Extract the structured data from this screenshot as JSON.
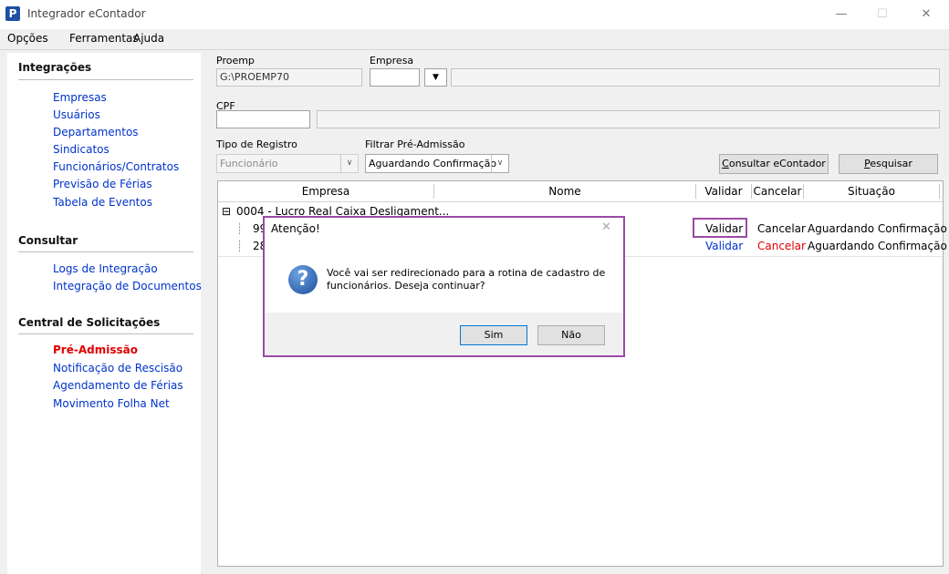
{
  "window": {
    "title": "Integrador eContador",
    "app_icon_glyph": "P",
    "controls": {
      "minimize": "—",
      "maximize": "☐",
      "close": "✕"
    }
  },
  "menu": [
    "Opções",
    "Ferramentas",
    "Ajuda"
  ],
  "sidebar": {
    "sections": [
      {
        "title": "Integrações",
        "items": [
          "Empresas",
          "Usuários",
          "Departamentos",
          "Sindicatos",
          "Funcionários/Contratos",
          "Previsão de Férias",
          "Tabela de Eventos"
        ]
      },
      {
        "title": "Consultar",
        "items": [
          "Logs de Integração",
          "Integração de Documentos"
        ]
      },
      {
        "title": "Central de Solicitações",
        "items": [
          "Pré-Admissão",
          "Notificação de Rescisão",
          "Agendamento de Férias",
          "Movimento Folha Net"
        ],
        "active": "Pré-Admissão"
      }
    ]
  },
  "form": {
    "proemp_label": "Proemp",
    "proemp_value": "G:\\PROEMP70",
    "empresa_label": "Empresa",
    "empresa_value": "",
    "empresa_name": "",
    "cpf_label": "CPF",
    "cpf_value": "",
    "cpf_name": "",
    "tipo_registro_label": "Tipo de Registro",
    "tipo_registro_value": "Funcionário",
    "filtrar_label": "Filtrar Pré-Admissão",
    "filtrar_value": "Aguardando Confirmação",
    "consultar_button": "Consultar eContador",
    "pesquisar_button": "Pesquisar"
  },
  "grid": {
    "columns": [
      "Empresa",
      "Nome",
      "Validar",
      "Cancelar",
      "Situação"
    ],
    "group": {
      "toggle": "⊟",
      "label": "0004 - Lucro Real Caixa Desligament..."
    },
    "rows": [
      {
        "id": "99",
        "validar": "Validar",
        "cancelar": "Cancelar",
        "situacao": "Aguardando Confirmação"
      },
      {
        "id": "28",
        "validar": "Validar",
        "cancelar": "Cancelar",
        "situacao": "Aguardando Confirmação"
      }
    ]
  },
  "dialog": {
    "title": "Atenção!",
    "message_line1": "Você vai ser redirecionado para a rotina de cadastro de",
    "message_line2": "funcionários. Deseja continuar?",
    "yes_button": "Sim",
    "no_button": "Não",
    "close_glyph": "✕",
    "icon": "question-icon"
  },
  "colors": {
    "highlight": "#9b4aa6",
    "link": "#0033cc",
    "active_link": "#e00000"
  }
}
